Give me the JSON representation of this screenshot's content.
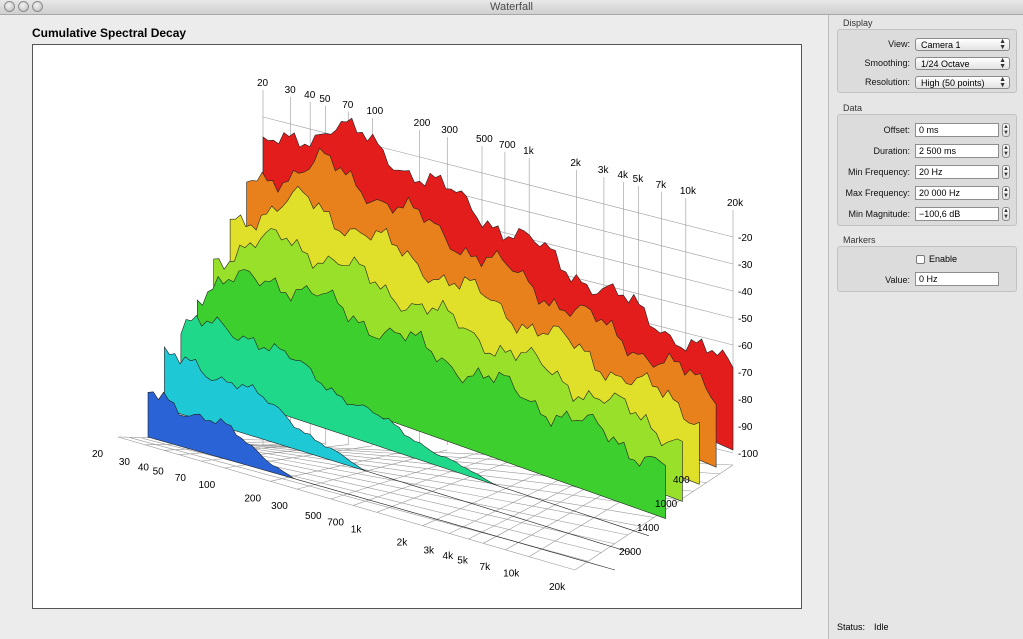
{
  "window": {
    "title": "Waterfall"
  },
  "plot": {
    "title": "Cumulative Spectral Decay"
  },
  "chart_data": {
    "type": "area",
    "title": "Cumulative Spectral Decay",
    "frequency_ticks": [
      "20",
      "30",
      "40",
      "50",
      "70",
      "100",
      "200",
      "300",
      "500",
      "700",
      "1k",
      "2k",
      "3k",
      "4k",
      "5k",
      "7k",
      "10k",
      "20k"
    ],
    "magnitude_ticks": [
      "-20",
      "-30",
      "-40",
      "-50",
      "-60",
      "-70",
      "-80",
      "-90",
      "-100"
    ],
    "time_ticks": [
      "400",
      "1000",
      "1400",
      "2000"
    ],
    "magnitude_range": [
      -100,
      -10
    ],
    "frequency_range": [
      20,
      20000
    ],
    "grid": true,
    "slice_colors": [
      "#e31c1c",
      "#e8801c",
      "#e0e02a",
      "#98e02a",
      "#3ccf2e",
      "#20d88a",
      "#1ec8d4",
      "#2a63d6"
    ]
  },
  "sidebar": {
    "display": {
      "label": "Display",
      "view_label": "View:",
      "view_value": "Camera 1",
      "smoothing_label": "Smoothing:",
      "smoothing_value": "1/24 Octave",
      "resolution_label": "Resolution:",
      "resolution_value": "High (50 points)"
    },
    "data": {
      "label": "Data",
      "offset_label": "Offset:",
      "offset_value": "0 ms",
      "duration_label": "Duration:",
      "duration_value": "2 500 ms",
      "min_freq_label": "Min Frequency:",
      "min_freq_value": "20 Hz",
      "max_freq_label": "Max Frequency:",
      "max_freq_value": "20 000 Hz",
      "min_mag_label": "Min Magnitude:",
      "min_mag_value": "−100,6 dB"
    },
    "markers": {
      "label": "Markers",
      "enable_label": "Enable",
      "value_label": "Value:",
      "value_value": "0 Hz"
    }
  },
  "status": {
    "label": "Status:",
    "value": "Idle"
  }
}
